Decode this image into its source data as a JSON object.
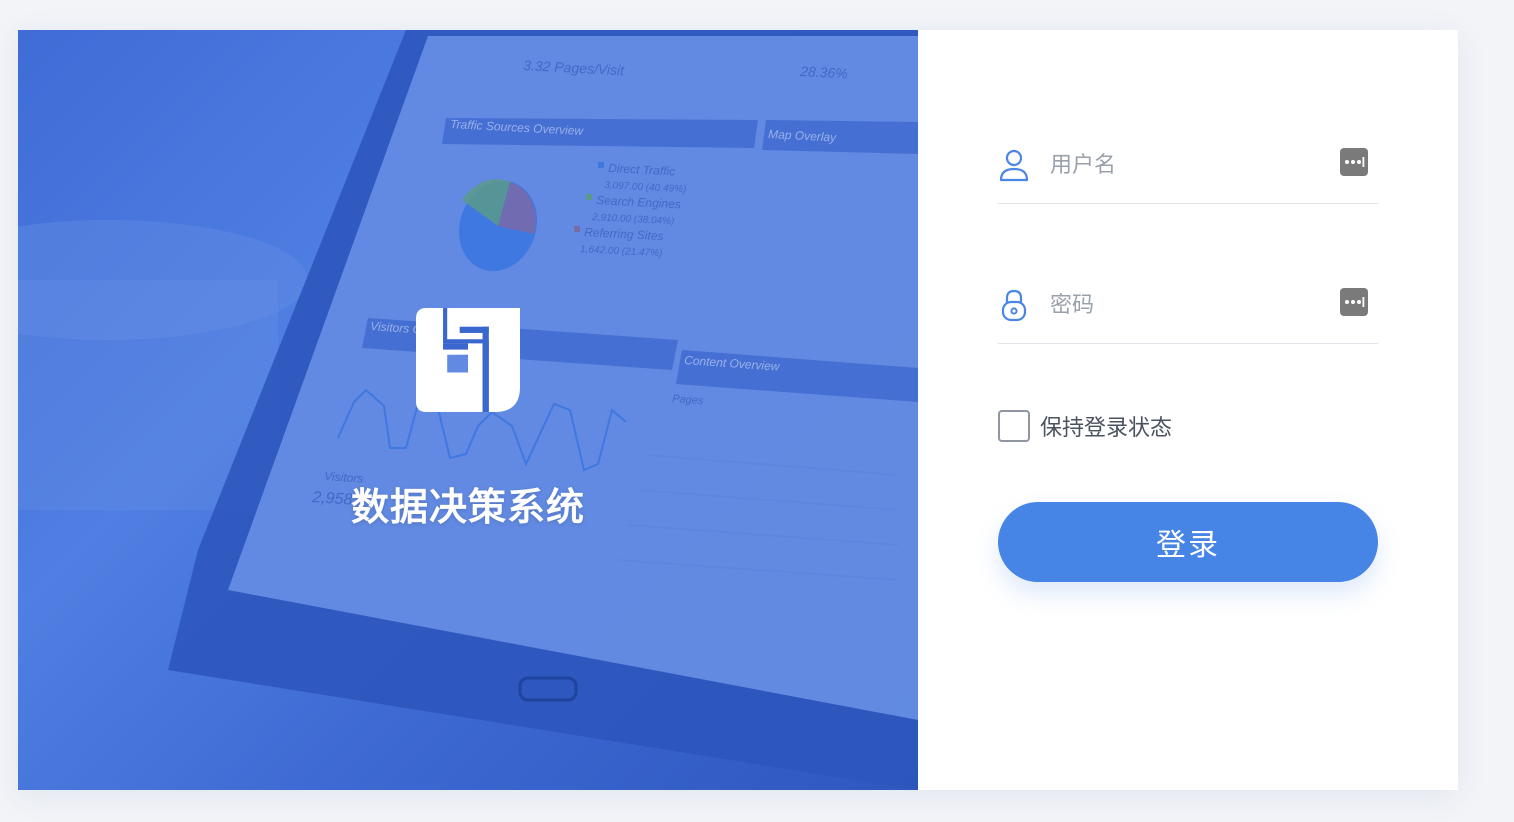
{
  "hero": {
    "title": "数据决策系统",
    "background": {
      "dashboard_header": "3.32 Pages/Visit",
      "dashboard_header_right": "28.36%",
      "traffic_panel_title": "Traffic Sources Overview",
      "map_panel_title": "Map Overlay",
      "visitors_panel_title": "Visitors Overview",
      "content_panel_title": "Content Overview",
      "content_column": "Pages",
      "legend": [
        {
          "label": "Direct Traffic",
          "value": "3,097.00 (40.49%)",
          "color": "#3f78e0"
        },
        {
          "label": "Search Engines",
          "value": "2,910.00 (38.04%)",
          "color": "#5a9a8a"
        },
        {
          "label": "Referring Sites",
          "value": "1,642.00 (21.47%)",
          "color": "#7a6aa8"
        }
      ],
      "visitors_label": "Visitors",
      "visitors_value": "2,958"
    }
  },
  "form": {
    "username_placeholder": "用户名",
    "password_placeholder": "密码",
    "remember_label": "保持登录状态",
    "login_label": "登录"
  },
  "colors": {
    "accent": "#4684e6",
    "hero_blue": "#3f6cd6",
    "icon_blue": "#4a86e4"
  }
}
